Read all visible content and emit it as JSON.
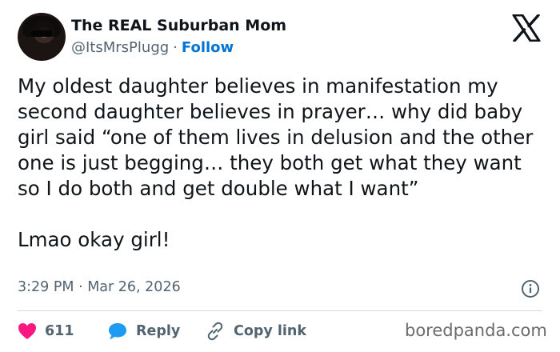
{
  "header": {
    "display_name": "The REAL Suburban Mom",
    "handle": "@ItsMrsPlugg",
    "separator": "·",
    "follow_label": "Follow"
  },
  "tweet": {
    "paragraph_1": "My oldest daughter believes in manifestation my second daughter believes in prayer… why did baby girl said “one of them lives in delusion and the other one is just begging… they both get what they want so I do both and get double what I want”",
    "paragraph_2": "Lmao okay girl!",
    "timestamp": "3:29 PM · Mar 26, 2026"
  },
  "actions": {
    "like_count": "611",
    "reply_label": "Reply",
    "copy_link_label": "Copy link"
  },
  "watermark": "boredpanda.com",
  "colors": {
    "like": "#f91880",
    "reply": "#1d9bf0",
    "follow": "#0074d4",
    "muted": "#536471",
    "divider": "#cfd9de"
  },
  "icons": [
    "x-logo-icon",
    "info-icon",
    "heart-icon",
    "reply-bubble-icon",
    "link-icon"
  ]
}
